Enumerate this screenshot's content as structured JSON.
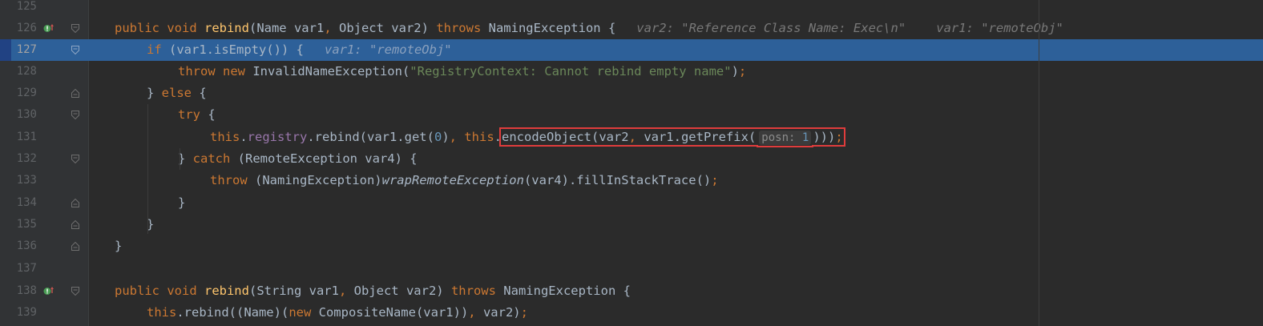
{
  "editor": {
    "colors": {
      "background": "#2b2b2b",
      "gutter": "#313335",
      "current_line": "#2d6099",
      "keyword": "#cc7832",
      "method_decl": "#ffc66d",
      "string": "#6a8759",
      "number": "#6897bb",
      "field": "#9876aa",
      "hint": "#787878",
      "highlight_box": "#e03c3c"
    },
    "gutter_icons": {
      "override": "override-up-arrow-icon",
      "fold": "fold-collapse-icon"
    },
    "lines": [
      {
        "num": "125"
      },
      {
        "num": "126",
        "kw1": "public void ",
        "fn": "rebind",
        "p1": "(Name var1",
        "c1": ", ",
        "p2": "Object var2) ",
        "kw2": "throws ",
        "p3": "NamingException {",
        "hint1": "var2: \"Reference Class Name: Exec\\n\"",
        "hint2": "var1: \"remoteObj\""
      },
      {
        "num": "127",
        "kw1": "if ",
        "p1": "(var1.isEmpty()) {",
        "hint1": "var1: \"remoteObj\""
      },
      {
        "num": "128",
        "kw1": "throw new ",
        "p1": "InvalidNameException(",
        "str": "\"RegistryContext: Cannot rebind empty name\"",
        "p2": ")",
        "semi": ";"
      },
      {
        "num": "129",
        "p1": "} ",
        "kw1": "else ",
        "p2": "{"
      },
      {
        "num": "130",
        "kw1": "try ",
        "p1": "{"
      },
      {
        "num": "131",
        "kw1": "this",
        "p1": ".",
        "field": "registry",
        "p2": ".rebind(var1.get(",
        "num0": "0",
        "p3": ")",
        "c1": ", ",
        "kw2": "this",
        "p4": ".",
        "boxed_a": "encodeObject(var2",
        "c2": ", ",
        "boxed_b": "var1.getPrefix(",
        "inlay_label": "posn:",
        "inlay_value": "1",
        "boxed_c": ")))",
        "semi": ";"
      },
      {
        "num": "132",
        "p1": "} ",
        "kw1": "catch ",
        "p2": "(RemoteException var4) {"
      },
      {
        "num": "133",
        "kw1": "throw ",
        "p1": "(NamingException)",
        "it": "wrapRemoteException",
        "p2": "(var4).fillInStackTrace()",
        "semi": ";"
      },
      {
        "num": "134",
        "p1": "}"
      },
      {
        "num": "135",
        "p1": "}"
      },
      {
        "num": "136",
        "p1": "}"
      },
      {
        "num": "137"
      },
      {
        "num": "138",
        "kw1": "public void ",
        "fn": "rebind",
        "p1": "(String var1",
        "c1": ", ",
        "p2": "Object var2) ",
        "kw2": "throws ",
        "p3": "NamingException {"
      },
      {
        "num": "139",
        "kw1": "this",
        "p1": ".rebind((Name)(",
        "kw2": "new ",
        "p2": "CompositeName(var1))",
        "c1": ", ",
        "p3": "var2)",
        "semi": ";"
      }
    ]
  }
}
